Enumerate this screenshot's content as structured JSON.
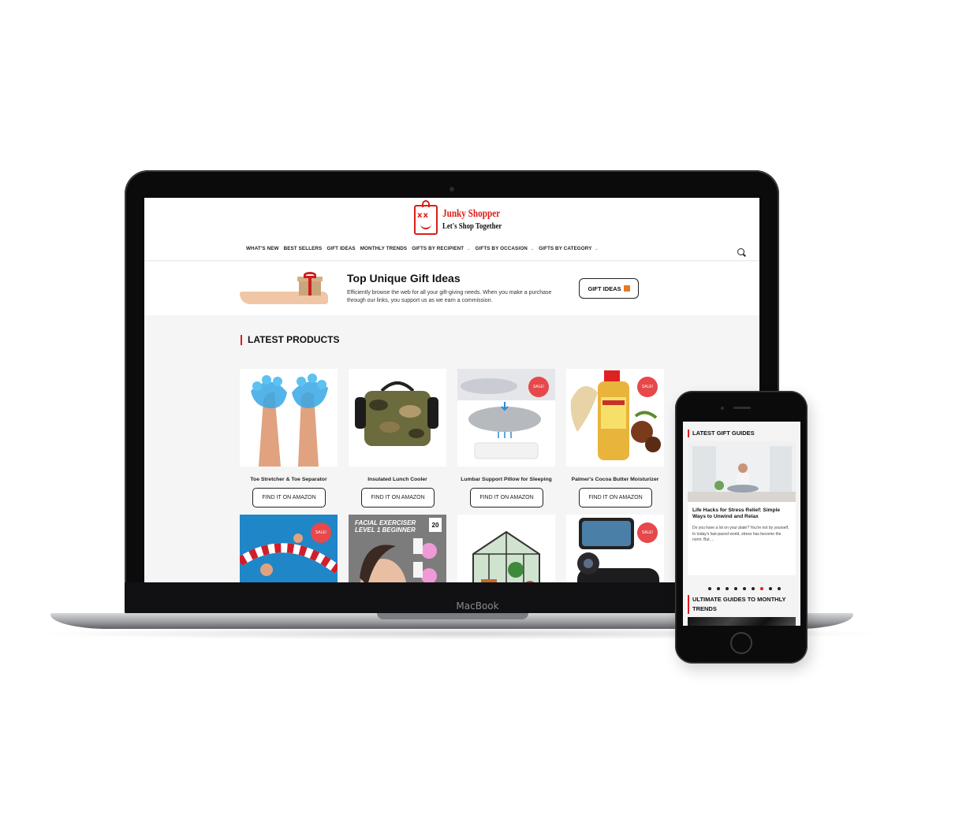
{
  "site": {
    "logo_title": "Junky Shopper",
    "logo_subtitle": "Let's Shop Together",
    "logo_face": "xx"
  },
  "nav": {
    "items": [
      {
        "label": "WHAT'S NEW",
        "dropdown": false
      },
      {
        "label": "BEST SELLERS",
        "dropdown": false
      },
      {
        "label": "GIFT IDEAS",
        "dropdown": false
      },
      {
        "label": "MONTHLY TRENDS",
        "dropdown": false
      },
      {
        "label": "GIFTS BY RECIPIENT",
        "dropdown": true
      },
      {
        "label": "GIFTS BY OCCASION",
        "dropdown": true
      },
      {
        "label": "GIFTS BY CATEGORY",
        "dropdown": true
      }
    ],
    "chevron": "⌄"
  },
  "hero": {
    "title": "Top Unique Gift Ideas",
    "text": "Efficiently browse the web for all your gift-giving needs. When you make a purchase through our links, you support us as we earn a commission.",
    "button_label": "GIFT IDEAS"
  },
  "latest_products": {
    "heading": "LATEST PRODUCTS",
    "sale_label": "SALE!",
    "button_label": "FIND IT ON AMAZON",
    "items": [
      {
        "name": "Toe Stretcher & Toe Separator",
        "sale": false
      },
      {
        "name": "Insulated Lunch Cooler",
        "sale": false
      },
      {
        "name": "Lumbar Support Pillow for Sleeping",
        "sale": true
      },
      {
        "name": "Palmer's Cocoa Butter Moisturizer",
        "sale": true
      },
      {
        "name": "",
        "sale": true
      },
      {
        "name": "",
        "sale": false,
        "image_text_1": "FACIAL EXERCISER",
        "image_text_2": "LEVEL 1 BEGINNER",
        "image_badge": "20"
      },
      {
        "name": "",
        "sale": false
      },
      {
        "name": "",
        "sale": true
      }
    ]
  },
  "device": {
    "laptop_label": "MacBook"
  },
  "mobile": {
    "heading": "LATEST GIFT GUIDES",
    "card_title": "Life Hacks for Stress Relief: Simple Ways to Unwind and Relax",
    "card_text": "Do you have a lot on your plate? You're not by yourself. In today's fast-paced world, stress has become the norm. But ...",
    "dots": 9,
    "active_dot": 7,
    "heading2": "ULTIMATE GUIDES TO MONTHLY TRENDS"
  }
}
